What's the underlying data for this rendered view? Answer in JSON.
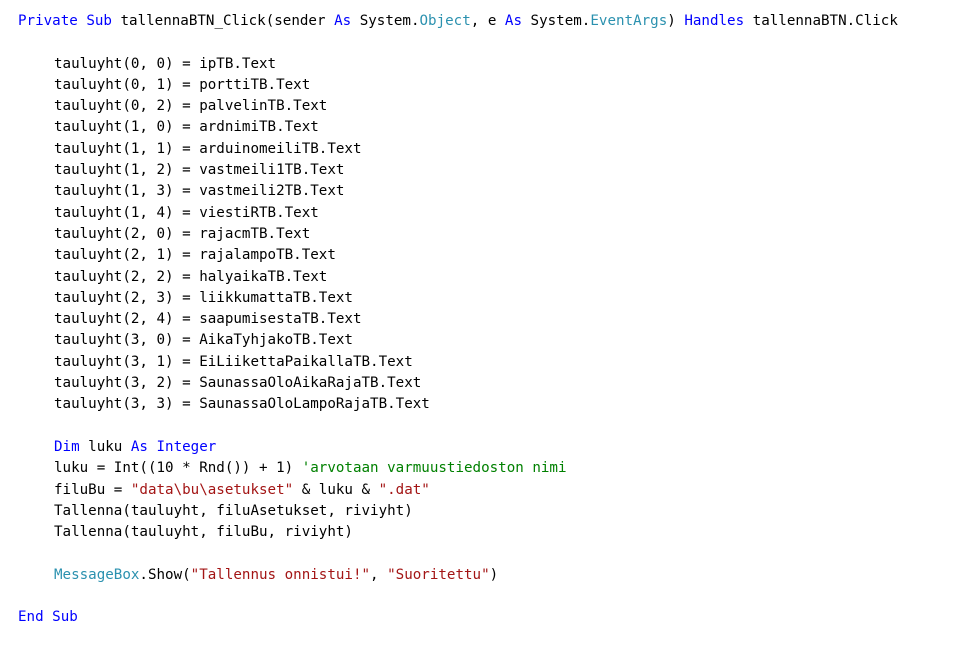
{
  "colors": {
    "background": "#ffffff",
    "plain": "#000000",
    "keyword": "#0000ff",
    "type": "#2b91af",
    "string": "#a31515",
    "comment": "#008000"
  },
  "code_lines": [
    {
      "indent": "",
      "tokens": [
        {
          "t": "kw",
          "v": "Private"
        },
        {
          "t": "pl",
          "v": " "
        },
        {
          "t": "kw",
          "v": "Sub"
        },
        {
          "t": "pl",
          "v": " tallennaBTN_Click(sender "
        },
        {
          "t": "kw",
          "v": "As"
        },
        {
          "t": "pl",
          "v": " System."
        },
        {
          "t": "ty",
          "v": "Object"
        },
        {
          "t": "pl",
          "v": ", e "
        },
        {
          "t": "kw",
          "v": "As"
        },
        {
          "t": "pl",
          "v": " System."
        },
        {
          "t": "ty",
          "v": "EventArgs"
        },
        {
          "t": "pl",
          "v": ") "
        },
        {
          "t": "kw",
          "v": "Handles"
        },
        {
          "t": "pl",
          "v": " tallennaBTN.Click"
        }
      ]
    },
    {
      "indent": "",
      "tokens": []
    },
    {
      "indent": "    ",
      "tokens": [
        {
          "t": "pl",
          "v": "tauluyht(0, 0) = ipTB.Text"
        }
      ]
    },
    {
      "indent": "    ",
      "tokens": [
        {
          "t": "pl",
          "v": "tauluyht(0, 1) = porttiTB.Text"
        }
      ]
    },
    {
      "indent": "    ",
      "tokens": [
        {
          "t": "pl",
          "v": "tauluyht(0, 2) = palvelinTB.Text"
        }
      ]
    },
    {
      "indent": "    ",
      "tokens": [
        {
          "t": "pl",
          "v": "tauluyht(1, 0) = ardnimiTB.Text"
        }
      ]
    },
    {
      "indent": "    ",
      "tokens": [
        {
          "t": "pl",
          "v": "tauluyht(1, 1) = arduinomeiliTB.Text"
        }
      ]
    },
    {
      "indent": "    ",
      "tokens": [
        {
          "t": "pl",
          "v": "tauluyht(1, 2) = vastmeili1TB.Text"
        }
      ]
    },
    {
      "indent": "    ",
      "tokens": [
        {
          "t": "pl",
          "v": "tauluyht(1, 3) = vastmeili2TB.Text"
        }
      ]
    },
    {
      "indent": "    ",
      "tokens": [
        {
          "t": "pl",
          "v": "tauluyht(1, 4) = viestiRTB.Text"
        }
      ]
    },
    {
      "indent": "    ",
      "tokens": [
        {
          "t": "pl",
          "v": "tauluyht(2, 0) = rajacmTB.Text"
        }
      ]
    },
    {
      "indent": "    ",
      "tokens": [
        {
          "t": "pl",
          "v": "tauluyht(2, 1) = rajalampoTB.Text"
        }
      ]
    },
    {
      "indent": "    ",
      "tokens": [
        {
          "t": "pl",
          "v": "tauluyht(2, 2) = halyaikaTB.Text"
        }
      ]
    },
    {
      "indent": "    ",
      "tokens": [
        {
          "t": "pl",
          "v": "tauluyht(2, 3) = liikkumattaTB.Text"
        }
      ]
    },
    {
      "indent": "    ",
      "tokens": [
        {
          "t": "pl",
          "v": "tauluyht(2, 4) = saapumisestaTB.Text"
        }
      ]
    },
    {
      "indent": "    ",
      "tokens": [
        {
          "t": "pl",
          "v": "tauluyht(3, 0) = AikaTyhjakoTB.Text"
        }
      ]
    },
    {
      "indent": "    ",
      "tokens": [
        {
          "t": "pl",
          "v": "tauluyht(3, 1) = EiLiikettaPaikallaTB.Text"
        }
      ]
    },
    {
      "indent": "    ",
      "tokens": [
        {
          "t": "pl",
          "v": "tauluyht(3, 2) = SaunassaOloAikaRajaTB.Text"
        }
      ]
    },
    {
      "indent": "    ",
      "tokens": [
        {
          "t": "pl",
          "v": "tauluyht(3, 3) = SaunassaOloLampoRajaTB.Text"
        }
      ]
    },
    {
      "indent": "",
      "tokens": []
    },
    {
      "indent": "    ",
      "tokens": [
        {
          "t": "kw",
          "v": "Dim"
        },
        {
          "t": "pl",
          "v": " luku "
        },
        {
          "t": "kw",
          "v": "As"
        },
        {
          "t": "pl",
          "v": " "
        },
        {
          "t": "kw",
          "v": "Integer"
        }
      ]
    },
    {
      "indent": "    ",
      "tokens": [
        {
          "t": "pl",
          "v": "luku = Int((10 * Rnd()) + 1) "
        },
        {
          "t": "cm",
          "v": "'arvotaan varmuustiedoston nimi"
        }
      ]
    },
    {
      "indent": "    ",
      "tokens": [
        {
          "t": "pl",
          "v": "filuBu = "
        },
        {
          "t": "str",
          "v": "\"data\\bu\\asetukset\""
        },
        {
          "t": "pl",
          "v": " & luku & "
        },
        {
          "t": "str",
          "v": "\".dat\""
        }
      ]
    },
    {
      "indent": "    ",
      "tokens": [
        {
          "t": "pl",
          "v": "Tallenna(tauluyht, filuAsetukset, riviyht)"
        }
      ]
    },
    {
      "indent": "    ",
      "tokens": [
        {
          "t": "pl",
          "v": "Tallenna(tauluyht, filuBu, riviyht)"
        }
      ]
    },
    {
      "indent": "",
      "tokens": []
    },
    {
      "indent": "    ",
      "tokens": [
        {
          "t": "ty",
          "v": "MessageBox"
        },
        {
          "t": "pl",
          "v": ".Show("
        },
        {
          "t": "str",
          "v": "\"Tallennus onnistui!\""
        },
        {
          "t": "pl",
          "v": ", "
        },
        {
          "t": "str",
          "v": "\"Suoritettu\""
        },
        {
          "t": "pl",
          "v": ")"
        }
      ]
    },
    {
      "indent": "",
      "tokens": []
    },
    {
      "indent": "",
      "tokens": [
        {
          "t": "kw",
          "v": "End"
        },
        {
          "t": "pl",
          "v": " "
        },
        {
          "t": "kw",
          "v": "Sub"
        }
      ]
    }
  ]
}
